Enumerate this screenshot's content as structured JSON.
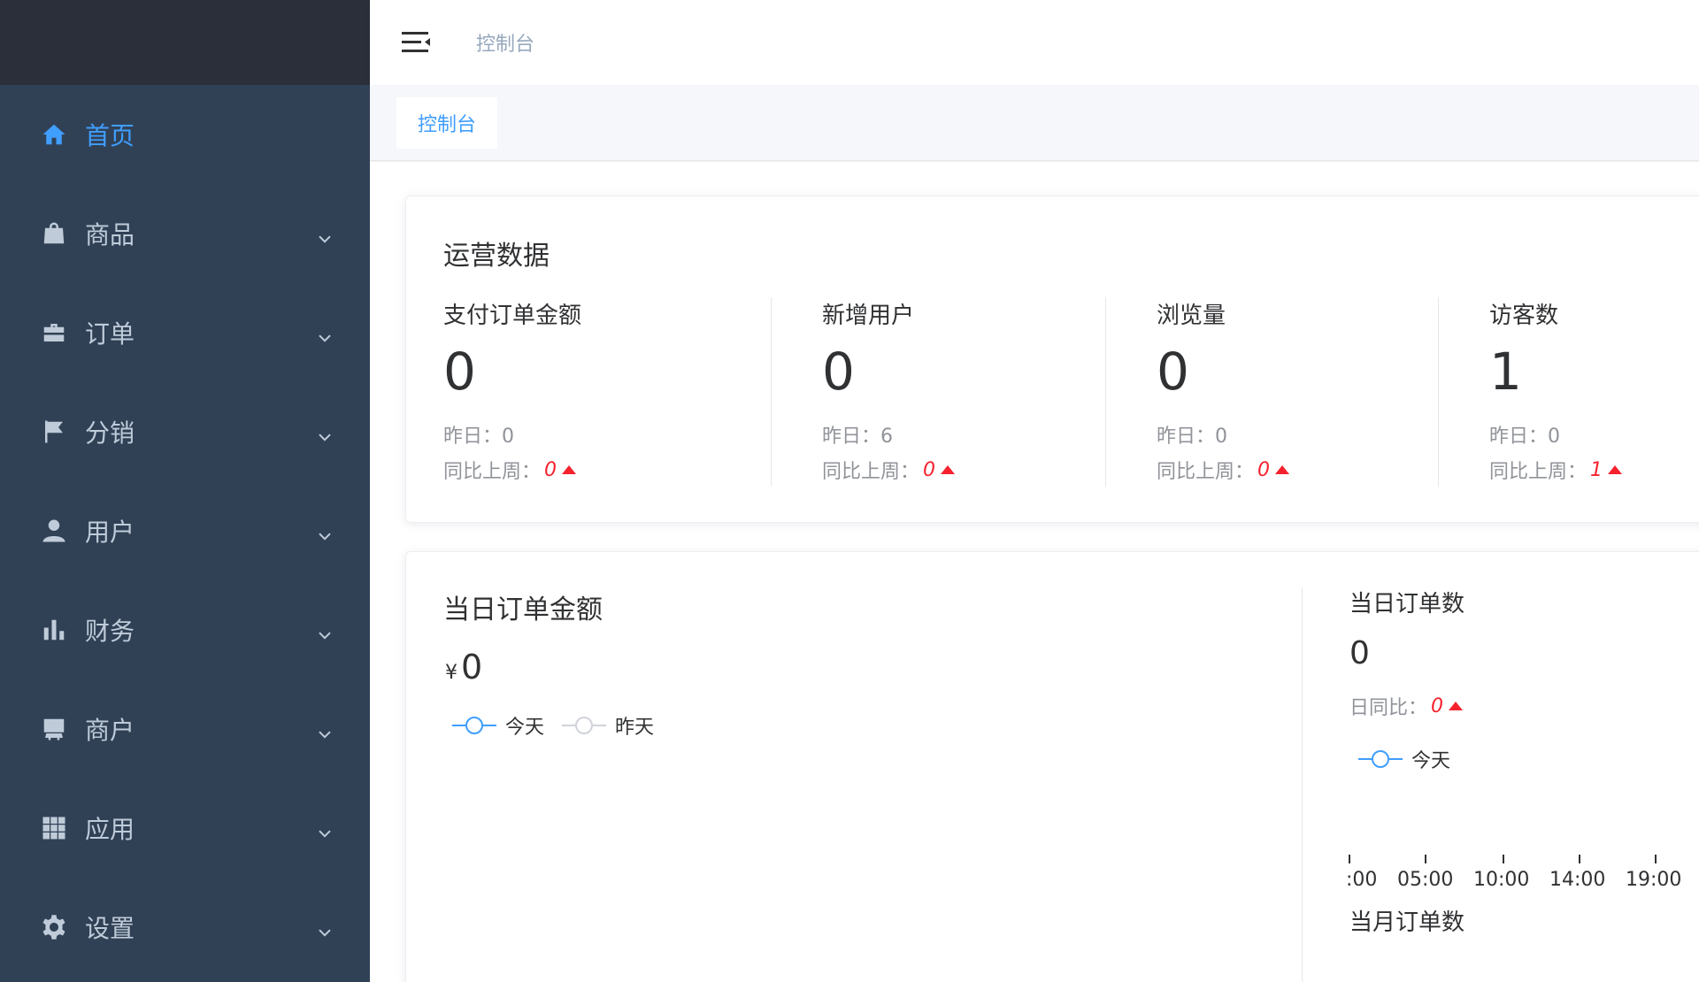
{
  "sidebar": {
    "items": [
      {
        "label": "首页",
        "icon": "home-icon",
        "active": true,
        "expandable": false
      },
      {
        "label": "商品",
        "icon": "shopping-bag-icon",
        "active": false,
        "expandable": true
      },
      {
        "label": "订单",
        "icon": "briefcase-icon",
        "active": false,
        "expandable": true
      },
      {
        "label": "分销",
        "icon": "flag-icon",
        "active": false,
        "expandable": true
      },
      {
        "label": "用户",
        "icon": "user-icon",
        "active": false,
        "expandable": true
      },
      {
        "label": "财务",
        "icon": "bar-chart-icon",
        "active": false,
        "expandable": true
      },
      {
        "label": "商户",
        "icon": "store-icon",
        "active": false,
        "expandable": true
      },
      {
        "label": "应用",
        "icon": "grid-icon",
        "active": false,
        "expandable": true
      },
      {
        "label": "设置",
        "icon": "gear-icon",
        "active": false,
        "expandable": true
      }
    ]
  },
  "header": {
    "breadcrumb": "控制台"
  },
  "tags": {
    "active_tag": "控制台"
  },
  "operations": {
    "title": "运营数据",
    "stats": [
      {
        "label": "支付订单金额",
        "value": "0",
        "yesterday_label": "昨日：",
        "yesterday": "0",
        "wow_label": "同比上周：",
        "wow": "0"
      },
      {
        "label": "新增用户",
        "value": "0",
        "yesterday_label": "昨日：",
        "yesterday": "6",
        "wow_label": "同比上周：",
        "wow": "0"
      },
      {
        "label": "浏览量",
        "value": "0",
        "yesterday_label": "昨日：",
        "yesterday": "0",
        "wow_label": "同比上周：",
        "wow": "0"
      },
      {
        "label": "访客数",
        "value": "1",
        "yesterday_label": "昨日：",
        "yesterday": "0",
        "wow_label": "同比上周：",
        "wow": "1"
      }
    ]
  },
  "order_amount": {
    "title": "当日订单金额",
    "currency": "¥",
    "value": "0",
    "legend": [
      "今天",
      "昨天"
    ]
  },
  "order_count": {
    "title": "当日订单数",
    "value": "0",
    "dod_label": "日同比：",
    "dod": "0",
    "legend": [
      "今天"
    ],
    "axis_ticks": [
      ":00",
      "05:00",
      "10:00",
      "14:00",
      "19:00"
    ],
    "month_title": "当月订单数"
  },
  "colors": {
    "accent": "#409eff",
    "sidebar_bg": "#304156",
    "up_red": "#f5222d",
    "yesterday_line": "#d0d3d8"
  }
}
